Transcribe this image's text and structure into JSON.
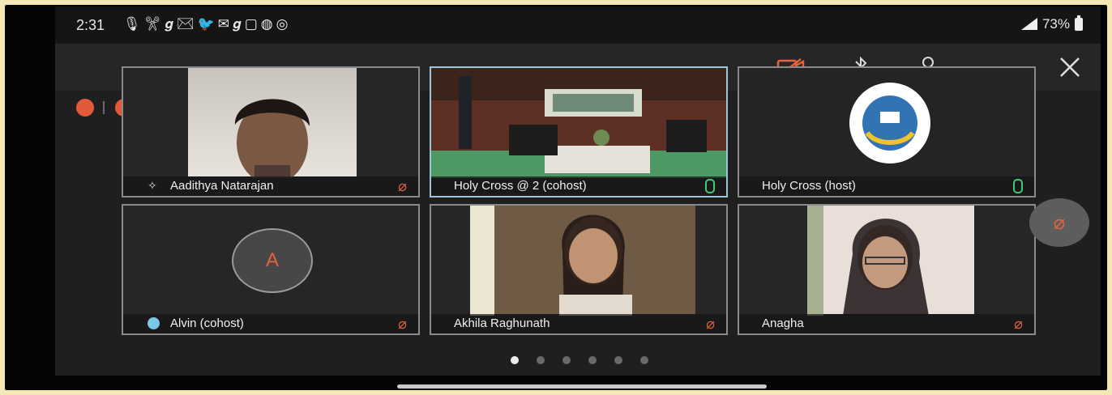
{
  "status_bar": {
    "time": "2:31",
    "notification_icons": [
      "mic-icon",
      "tools-icon",
      "g-icon",
      "mail-icon",
      "twitter-icon",
      "mail-icon",
      "g-icon",
      "calendar-icon",
      "whatsapp-icon",
      "chrome-icon"
    ],
    "notification_glyphs": "🎙✂𝒈✉🐦✉𝒈▢◍◎",
    "battery": "73%"
  },
  "toolbar": {
    "icons": [
      "video-off-icon",
      "bluetooth-icon",
      "participants-icon",
      "more-icon",
      "close-icon"
    ]
  },
  "participants": [
    {
      "name": "Aadithya Natarajan",
      "muted": true,
      "pinned": true
    },
    {
      "name": "Holy Cross @ 2 (cohost)",
      "muted": false,
      "active": true
    },
    {
      "name": "Holy Cross (host)",
      "muted": false
    },
    {
      "name": "Alvin (cohost)",
      "muted": true,
      "avatar_letter": "A"
    },
    {
      "name": "Akhila Raghunath",
      "muted": true
    },
    {
      "name": "Anagha",
      "muted": true
    }
  ],
  "pagination": {
    "pages": 6,
    "current": 1
  },
  "colors": {
    "accent": "#e2623e",
    "mic_on": "#3ecb74",
    "active_border": "#9ec4d8"
  }
}
